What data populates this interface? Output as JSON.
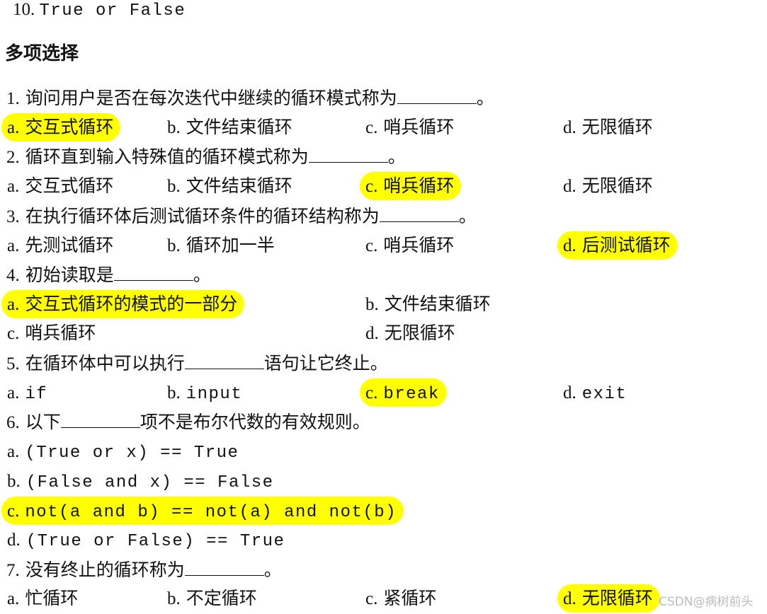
{
  "top_line": {
    "number": "10.",
    "code": "True or False"
  },
  "section_title": "多项选择",
  "highlight_color": "#ffff00",
  "questions": [
    {
      "prompt_before": "询问用户是否在每次迭代中继续的循环模式称为",
      "prompt_after": "。",
      "number": "1.",
      "options": [
        {
          "letter": "a.",
          "text": "交互式循环",
          "correct": true
        },
        {
          "letter": "b.",
          "text": "文件结束循环",
          "correct": false
        },
        {
          "letter": "c.",
          "text": "哨兵循环",
          "correct": false
        },
        {
          "letter": "d.",
          "text": "无限循环",
          "correct": false
        }
      ]
    },
    {
      "number": "2.",
      "prompt_before": "循环直到输入特殊值的循环模式称为",
      "prompt_after": "。",
      "options": [
        {
          "letter": "a.",
          "text": "交互式循环",
          "correct": false
        },
        {
          "letter": "b.",
          "text": "文件结束循环",
          "correct": false
        },
        {
          "letter": "c.",
          "text": "哨兵循环",
          "correct": true
        },
        {
          "letter": "d.",
          "text": "无限循环",
          "correct": false
        }
      ]
    },
    {
      "number": "3.",
      "prompt_before": "在执行循环体后测试循环条件的循环结构称为",
      "prompt_after": "。",
      "options": [
        {
          "letter": "a.",
          "text": "先测试循环",
          "correct": false
        },
        {
          "letter": "b.",
          "text": "循环加一半",
          "correct": false
        },
        {
          "letter": "c.",
          "text": "哨兵循环",
          "correct": false
        },
        {
          "letter": "d.",
          "text": "后测试循环",
          "correct": true
        }
      ]
    },
    {
      "number": "4.",
      "prompt_before": "初始读取是",
      "prompt_after": "。",
      "options": [
        {
          "letter": "a.",
          "text": "交互式循环的模式的一部分",
          "correct": true
        },
        {
          "letter": "b.",
          "text": "文件结束循环",
          "correct": false
        },
        {
          "letter": "c.",
          "text": "哨兵循环",
          "correct": false
        },
        {
          "letter": "d.",
          "text": "无限循环",
          "correct": false
        }
      ]
    },
    {
      "number": "5.",
      "prompt_before": "在循环体中可以执行",
      "prompt_after": "语句让它终止。",
      "options": [
        {
          "letter": "a.",
          "text": "if",
          "correct": false
        },
        {
          "letter": "b.",
          "text": "input",
          "correct": false
        },
        {
          "letter": "c.",
          "text": "break",
          "correct": true
        },
        {
          "letter": "d.",
          "text": "exit",
          "correct": false
        }
      ]
    },
    {
      "number": "6.",
      "prompt_before": "以下",
      "prompt_after": "项不是布尔代数的有效规则。",
      "options": [
        {
          "letter": "a.",
          "text": "(True or x) == True",
          "correct": false
        },
        {
          "letter": "b.",
          "text": "(False and x) == False",
          "correct": false
        },
        {
          "letter": "c.",
          "text": "not(a and b) == not(a) and not(b)",
          "correct": true
        },
        {
          "letter": "d.",
          "text": "(True or False) == True",
          "correct": false
        }
      ]
    },
    {
      "number": "7.",
      "prompt_before": "没有终止的循环称为",
      "prompt_after": "。",
      "options": [
        {
          "letter": "a.",
          "text": "忙循环",
          "correct": false
        },
        {
          "letter": "b.",
          "text": "不定循环",
          "correct": false
        },
        {
          "letter": "c.",
          "text": "紧循环",
          "correct": false
        },
        {
          "letter": "d.",
          "text": "无限循环",
          "correct": true
        }
      ]
    }
  ],
  "watermark": "CSDN@病树前头"
}
